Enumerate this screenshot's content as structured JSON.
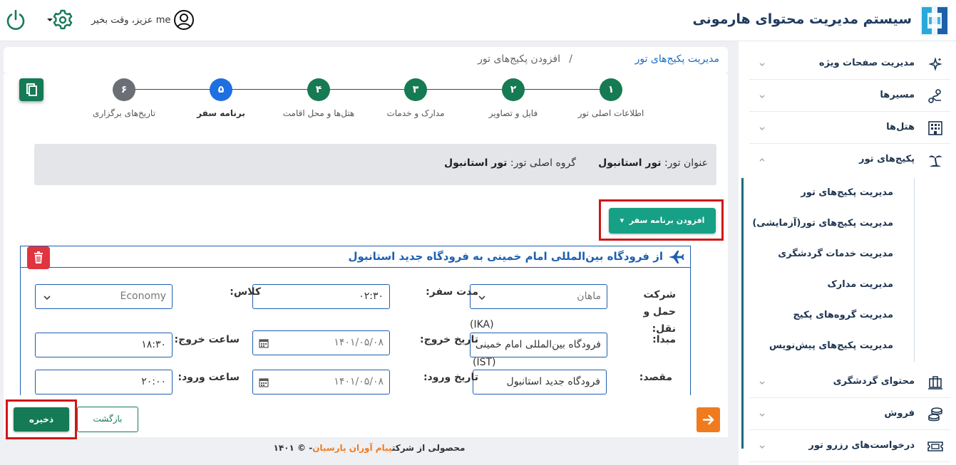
{
  "header": {
    "app_title": "سیستم مدیریت محتوای هارمونی",
    "greeting": "me عزیز، وقت بخیر"
  },
  "breadcrumb": {
    "parent": "مدیریت پکیج‌های تور",
    "separator": "/",
    "current": "افزودن پکیج‌های تور"
  },
  "stepper": {
    "steps": [
      {
        "number": "۱",
        "label": "اطلاعات اصلی تور",
        "status": "done",
        "color": "#167a52"
      },
      {
        "number": "۲",
        "label": "فایل و تصاویر",
        "status": "done",
        "color": "#167a52"
      },
      {
        "number": "۳",
        "label": "مدارک و خدمات",
        "status": "done",
        "color": "#167a52"
      },
      {
        "number": "۴",
        "label": "هتل‌ها و محل اقامت",
        "status": "done",
        "color": "#167a52"
      },
      {
        "number": "۵",
        "label": "برنامه سفر",
        "status": "active",
        "color": "#1e6fe0"
      },
      {
        "number": "۶",
        "label": "تاریخ‌های برگزاری",
        "status": "pending",
        "color": "#6b6f75"
      }
    ]
  },
  "tour_info": {
    "title_label": "عنوان تور:",
    "title_value": "تور استانبول",
    "group_label": "گروه اصلی تور:",
    "group_value": "تور استانبول"
  },
  "add_itinerary_button": "افزودن برنامه سفر",
  "itinerary": {
    "title": "از فرودگاه بین‌المللی امام خمینی به فرودگاه جدید استانبول",
    "carrier_label": "شرکت حمل و نقل:",
    "carrier_value": "ماهان",
    "duration_label": "مدت سفر:",
    "duration_value": "۰۲:۳۰",
    "class_label": "کلاس:",
    "class_value": "Economy",
    "origin_label": "مبدا:",
    "origin_code": "(IKA)",
    "origin_value": "فرودگاه بین‌المللی امام خمینی",
    "departure_date_label": "تاریخ خروج:",
    "departure_date_value": "۱۴۰۱/۰۵/۰۸",
    "departure_time_label": "ساعت خروج:",
    "departure_time_value": "۱۸:۳۰",
    "destination_label": "مقصد:",
    "destination_code": "(IST)",
    "destination_value": "فرودگاه جدید استانبول",
    "arrival_date_label": "تاریخ ورود:",
    "arrival_date_value": "۱۴۰۱/۰۵/۰۸",
    "arrival_time_label": "ساعت ورود:",
    "arrival_time_value": "۲۰:۰۰"
  },
  "actions": {
    "save": "ذخیره",
    "back": "بازگشت"
  },
  "footer": {
    "prefix": "محصولی از شرکت",
    "company": "پیام آوران پارسیان",
    "suffix": "- © ۱۴۰۱"
  },
  "sidebar": {
    "items": [
      {
        "label": "مدیریت صفحات ویژه",
        "icon": "sparkles-icon"
      },
      {
        "label": "مسیرها",
        "icon": "route-icon"
      },
      {
        "label": "هتل‌ها",
        "icon": "hotel-icon"
      },
      {
        "label": "پکیج‌های تور",
        "icon": "palm-tree-icon",
        "expanded": true
      },
      {
        "label": "محتوای گردشگری",
        "icon": "luggage-icon"
      },
      {
        "label": "فروش",
        "icon": "coins-icon"
      },
      {
        "label": "درخواست‌های رزرو تور",
        "icon": "ticket-icon"
      }
    ],
    "tour_subitems": [
      "مدیریت پکیج‌های تور",
      "مدیریت پکیج‌های تور(آزمایشی)",
      "مدیریت خدمات گردشگری",
      "مدیریت مدارک",
      "مدیریت گروه‌های پکیج",
      "مدیریت پکیج‌های پیش‌نویس"
    ]
  },
  "colors": {
    "brand_green": "#157a56",
    "teal_button": "#16a085",
    "link_blue": "#1a6fc4",
    "highlight_red": "#d01717",
    "accent_orange": "#f07b1e"
  }
}
